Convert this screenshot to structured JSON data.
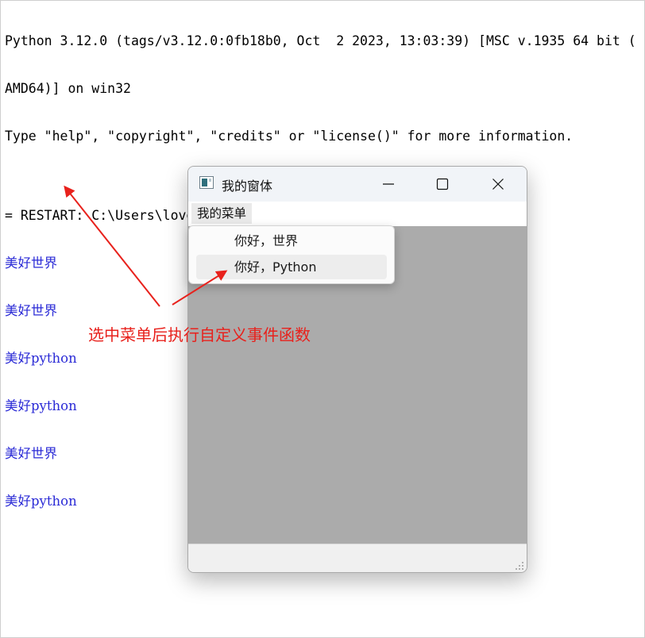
{
  "shell": {
    "lines": [
      "Python 3.12.0 (tags/v3.12.0:0fb18b0, Oct  2 2023, 13:03:39) [MSC v.1935 64 bit (",
      "AMD64)] on win32",
      "Type \"help\", \"copyright\", \"credits\" or \"license()\" for more information.",
      "",
      "= RESTART: C:\\Users\\love\\Documents\\Temp\\frame.py"
    ],
    "output": [
      "美好世界",
      "美好世界",
      "美好python",
      "美好python",
      "美好世界",
      "美好python"
    ]
  },
  "window": {
    "title": "我的窗体",
    "icon": "app-window-icon",
    "controls": [
      "minimize-icon",
      "maximize-icon",
      "close-icon"
    ]
  },
  "menubar": {
    "menu_label": "我的菜单"
  },
  "dropdown": {
    "items": [
      {
        "label": "你好，世界",
        "highlighted": false
      },
      {
        "label": "你好，Python",
        "highlighted": true
      }
    ]
  },
  "annotation": {
    "text": "选中菜单后执行自定义事件函数",
    "color": "#e8211c"
  },
  "colors": {
    "output_text": "#2a2ad6",
    "canvas_bg": "#ababab",
    "titlebar_bg": "#f1f4f8"
  }
}
